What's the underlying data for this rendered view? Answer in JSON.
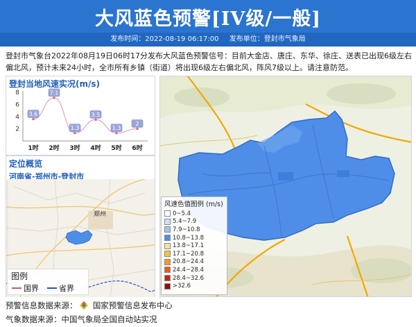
{
  "header": {
    "title": "大风蓝色预警[IV级/一般]",
    "publish_time": "发布时间：2022-08-19 06:17:00",
    "publisher": "发布单位：登封市气象局"
  },
  "description": "登封市气象台2022年08月19日06时17分发布大风蓝色预警信号：目前大金店、唐庄、东华、徐庄、送表已出现6级左右偏北风，预计未来24小时，全市所有乡镇（街道）将出现6级左右偏北风，阵风7级以上。请注意防范。",
  "wind_panel": {
    "title": "登封当地风速实况(m/s)"
  },
  "chart_data": {
    "type": "line",
    "categories": [
      "1时",
      "2时",
      "3时",
      "4时",
      "5时",
      "6时"
    ],
    "values": [
      3.6,
      7.1,
      1.3,
      3.5,
      1.3,
      2
    ],
    "ylim": [
      0,
      8
    ],
    "yticks": [
      2,
      4,
      6,
      8
    ],
    "grid": false
  },
  "location_panel": {
    "title": "定位概览",
    "subtitle": "河南省-郑州市-登封市",
    "legend_title": "图例",
    "legend_items": [
      {
        "label": "国界",
        "color": "#c05a7a"
      },
      {
        "label": "省界",
        "color": "#1b55c8"
      }
    ],
    "city_label": "郑州"
  },
  "speed_legend": {
    "title": "风速色值图例 (m/s)",
    "items": [
      {
        "label": "0~5.4",
        "color": "#ffffff"
      },
      {
        "label": "5.4~7.9",
        "color": "#cfe3f7"
      },
      {
        "label": "7.9~10.8",
        "color": "#9fc6ef"
      },
      {
        "label": "10.8~13.8",
        "color": "#4f8ee8"
      },
      {
        "label": "13.8~17.1",
        "color": "#f7e2a4"
      },
      {
        "label": "17.1~20.8",
        "color": "#f3c53e"
      },
      {
        "label": "20.8~24.4",
        "color": "#f39a22"
      },
      {
        "label": "24.4~28.4",
        "color": "#ea5b1b"
      },
      {
        "label": "28.4~32.6",
        "color": "#cc2416"
      },
      {
        "label": ">32.6",
        "color": "#8a1010"
      }
    ]
  },
  "footer": {
    "warning_source": "预警信息数据来源：",
    "warning_source_org": "国家预警信息发布中心",
    "weather_source": "气象数据来源：中国气象局全国自动站实况"
  },
  "colors": {
    "header_bg": "#2b74cf",
    "region_fill": "#4f8ee8",
    "accent": "#1f5fb8"
  }
}
